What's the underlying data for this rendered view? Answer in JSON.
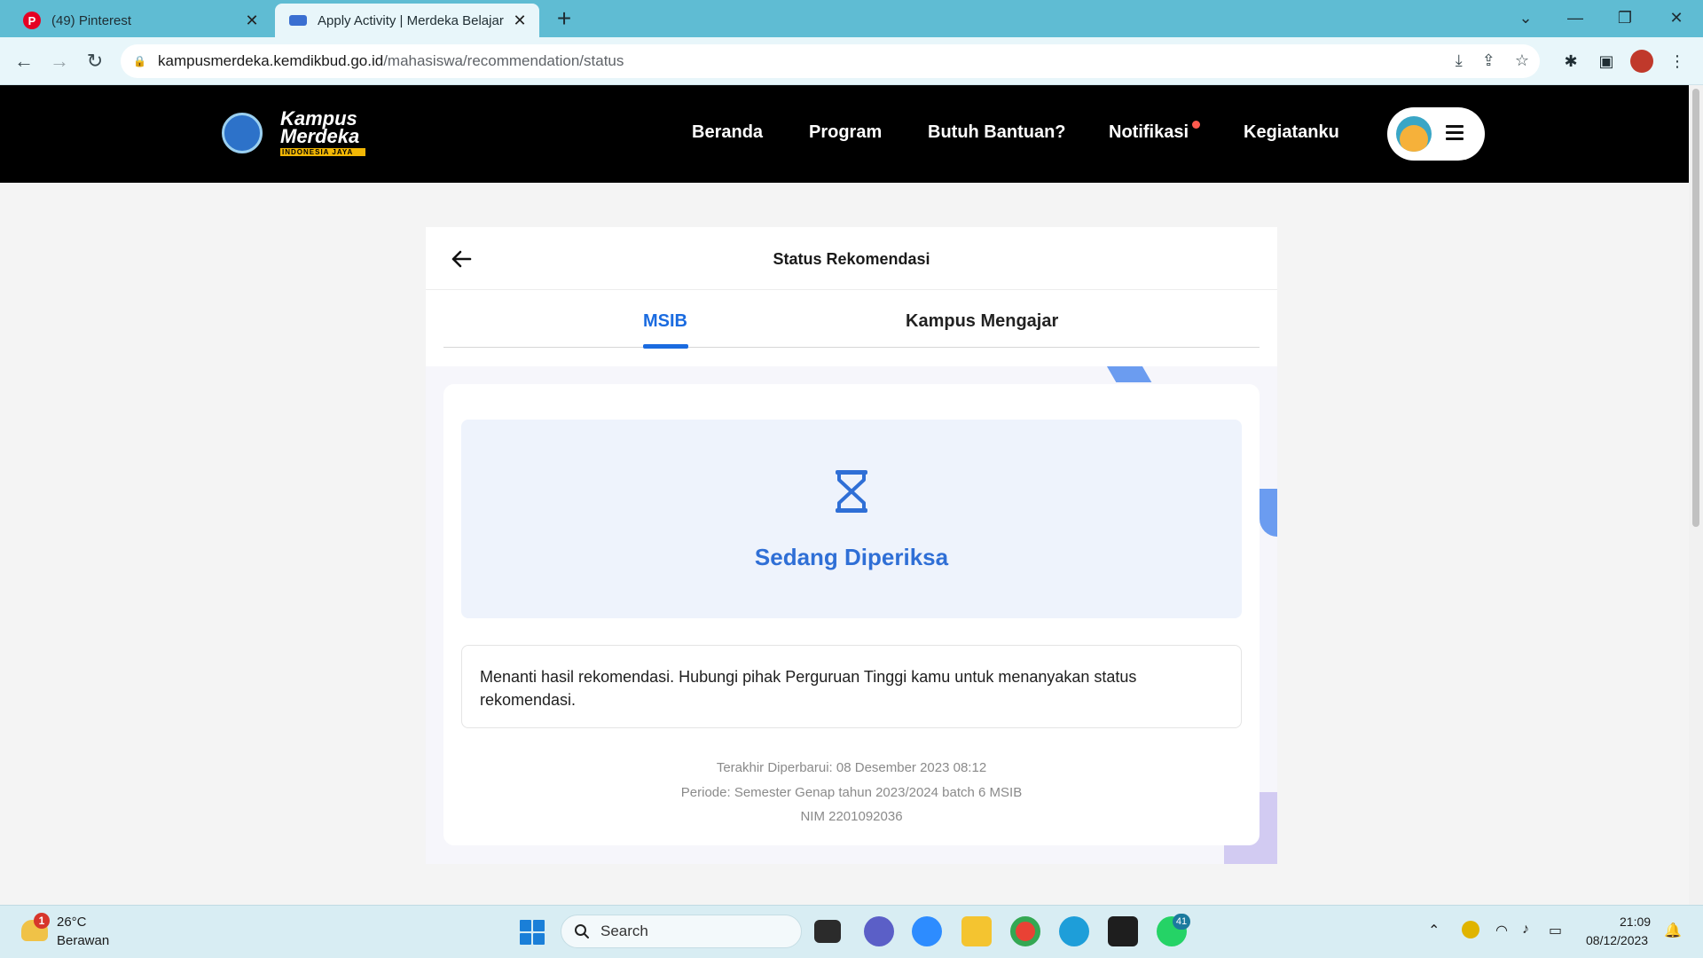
{
  "browser": {
    "tabs": [
      {
        "title": "(49) Pinterest",
        "active": false,
        "icon": "pinterest-icon"
      },
      {
        "title": "Apply Activity | Merdeka Belajar",
        "active": true,
        "icon": "kampus-merdeka-favicon"
      }
    ],
    "new_tab_label": "+",
    "url_host": "kampusmerdeka.kemdikbud.go.id",
    "url_path": "/mahasiswa/recommendation/status",
    "pinterest_glyph": "P"
  },
  "site": {
    "logo_line1": "Kampus",
    "logo_line2": "Merdeka",
    "logo_tagline": "INDONESIA JAYA",
    "nav": [
      "Beranda",
      "Program",
      "Butuh Bantuan?",
      "Notifikasi",
      "Kegiatanku"
    ],
    "accent_color": "#1a6be0"
  },
  "page": {
    "title": "Status Rekomendasi",
    "tabs": [
      "MSIB",
      "Kampus Mengajar"
    ],
    "active_tab": "MSIB",
    "status_label": "Sedang Diperiksa",
    "message": "Menanti hasil rekomendasi. Hubungi pihak Perguruan Tinggi kamu untuk menanyakan status rekomendasi.",
    "last_updated": "Terakhir Diperbarui: 08 Desember 2023 08:12",
    "period": "Periode: Semester Genap tahun 2023/2024 batch 6 MSIB",
    "nim": "NIM 2201092036"
  },
  "taskbar": {
    "weather_temp": "26°C",
    "weather_desc": "Berawan",
    "weather_badge": "1",
    "search_placeholder": "Search",
    "whatsapp_badge": "41",
    "time": "21:09",
    "date": "08/12/2023"
  }
}
